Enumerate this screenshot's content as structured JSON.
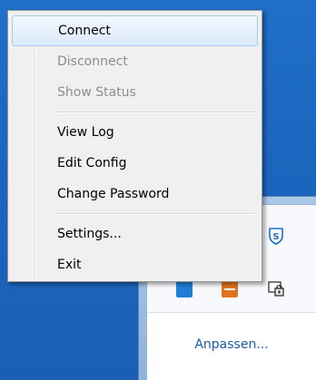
{
  "menu": {
    "items": [
      {
        "label": "Connect",
        "state": "highlighted"
      },
      {
        "label": "Disconnect",
        "state": "disabled"
      },
      {
        "label": "Show Status",
        "state": "disabled"
      },
      {
        "label": "View Log",
        "state": "enabled"
      },
      {
        "label": "Edit Config",
        "state": "enabled"
      },
      {
        "label": "Change Password",
        "state": "enabled"
      },
      {
        "label": "Settings...",
        "state": "enabled"
      },
      {
        "label": "Exit",
        "state": "enabled"
      }
    ]
  },
  "tray": {
    "customize_label": "Anpassen...",
    "icons": [
      "s5-shield-icon",
      "blue-app-icon",
      "orange-app-icon",
      "network-lock-icon"
    ]
  },
  "colors": {
    "desktop": "#1c66bf",
    "menu_bg": "#f0f0f0",
    "highlight": "#dceafb",
    "link": "#1a5aa8",
    "disabled_text": "#8d8d8d"
  }
}
